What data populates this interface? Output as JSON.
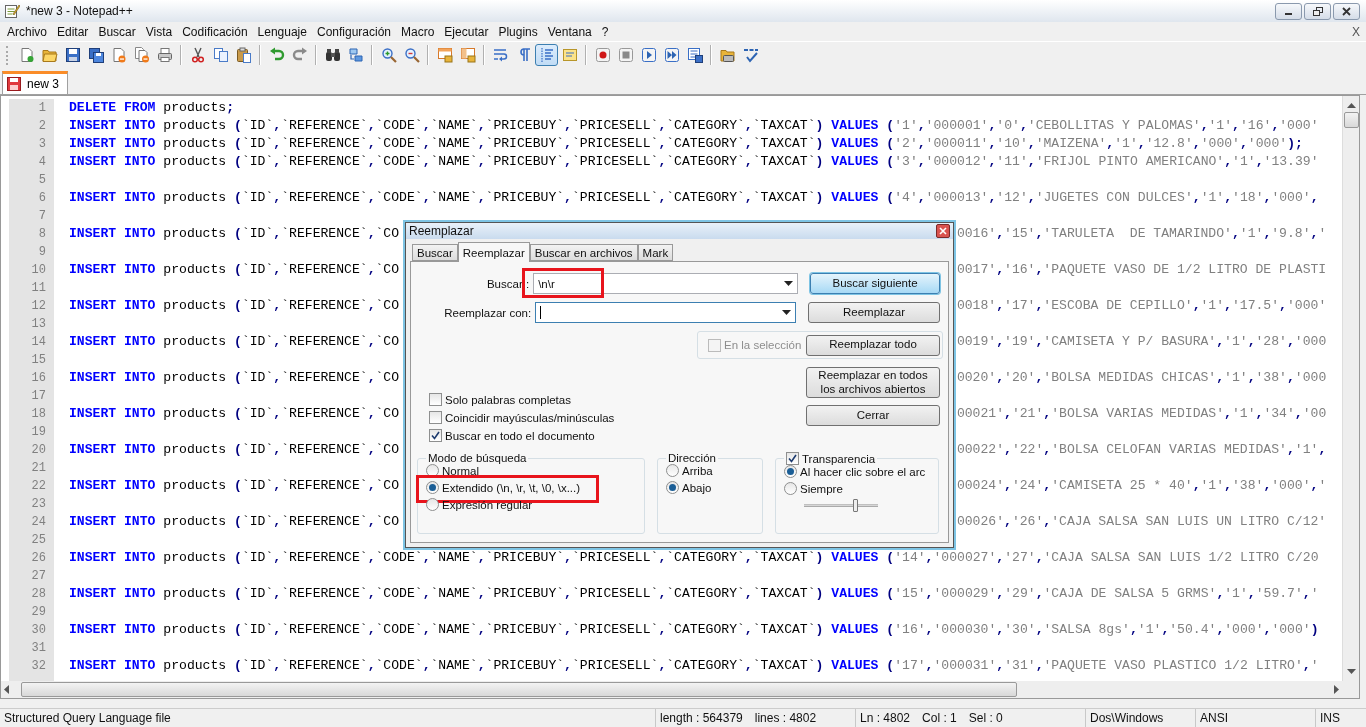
{
  "window": {
    "title": "*new 3 - Notepad++",
    "close_document": "X"
  },
  "menu": [
    "Archivo",
    "Editar",
    "Buscar",
    "Vista",
    "Codificación",
    "Lenguaje",
    "Configuración",
    "Macro",
    "Ejecutar",
    "Plugins",
    "Ventana",
    "?"
  ],
  "toolbar": [
    [
      {
        "pressed": false
      },
      {
        "pressed": false
      },
      {
        "pressed": false
      },
      {
        "pressed": false
      },
      {
        "pressed": false
      },
      {
        "pressed": false
      },
      {
        "pressed": false
      }
    ],
    [
      {
        "pressed": false
      },
      {
        "pressed": false
      },
      {
        "pressed": false
      }
    ],
    [
      {
        "pressed": false
      },
      {
        "pressed": false
      }
    ],
    [
      {
        "pressed": false
      },
      {
        "pressed": false
      }
    ],
    [
      {
        "pressed": false
      },
      {
        "pressed": false
      }
    ],
    [
      {
        "pressed": false
      },
      {
        "pressed": false
      }
    ],
    [
      {
        "pressed": false
      },
      {
        "pressed": false
      },
      {
        "pressed": true
      },
      {
        "pressed": false
      }
    ],
    [
      {
        "pressed": false
      },
      {
        "pressed": false
      },
      {
        "pressed": false
      },
      {
        "pressed": false
      },
      {
        "pressed": false
      }
    ],
    [
      {
        "pressed": false
      },
      {
        "pressed": false
      }
    ]
  ],
  "tabs": [
    {
      "label": "new 3",
      "selected": true
    }
  ],
  "editor": {
    "lines": [
      {
        "number": "1",
        "text": "DELETE FROM products;"
      },
      {
        "number": "2",
        "text": "INSERT INTO products (`ID`,`REFERENCE`,`CODE`,`NAME`,`PRICEBUY`,`PRICESELL`,`CATEGORY`,`TAXCAT`) VALUES ('1','000001','0','CEBOLLITAS Y PALOMAS','1','16','000'"
      },
      {
        "number": "3",
        "text": "INSERT INTO products (`ID`,`REFERENCE`,`CODE`,`NAME`,`PRICEBUY`,`PRICESELL`,`CATEGORY`,`TAXCAT`) VALUES ('2','000011','10','MAIZENA','1','12.8','000','000');"
      },
      {
        "number": "4",
        "text": "INSERT INTO products (`ID`,`REFERENCE`,`CODE`,`NAME`,`PRICEBUY`,`PRICESELL`,`CATEGORY`,`TAXCAT`) VALUES ('3','000012','11','FRIJOL PINTO AMERICANO','1','13.39'"
      },
      {
        "number": "5"
      },
      {
        "number": "6",
        "text": "INSERT INTO products (`ID`,`REFERENCE`,`CODE`,`NAME`,`PRICEBUY`,`PRICESELL`,`CATEGORY`,`TAXCAT`) VALUES ('4','000013','12','JUGETES CON DULCES','1','18','000',"
      },
      {
        "number": "7"
      },
      {
        "number": "8",
        "text": "INSERT INTO products (`ID`,`REFERENCE`,`CO",
        "text_right": "0016','15','TARULETA  DE TAMARINDO','1','9.8','"
      },
      {
        "number": "9"
      },
      {
        "number": "10",
        "text": "INSERT INTO products (`ID`,`REFERENCE`,`CO",
        "text_right": "0017','16','PAQUETE VASO DE 1/2 LITRO DE PLASTI"
      },
      {
        "number": "11"
      },
      {
        "number": "12",
        "text": "INSERT INTO products (`ID`,`REFERENCE`,`CO",
        "text_right": "0018','17','ESCOBA DE CEPILLO','1','17.5','000'"
      },
      {
        "number": "13"
      },
      {
        "number": "14",
        "text": "INSERT INTO products (`ID`,`REFERENCE`,`CO",
        "text_right": "0019','19','CAMISETA Y P/ BASURA','1','28','000"
      },
      {
        "number": "15"
      },
      {
        "number": "16",
        "text": "INSERT INTO products (`ID`,`REFERENCE`,`CO",
        "text_right": "0020','20','BOLSA MEDIDAS CHICAS','1','38','000"
      },
      {
        "number": "17"
      },
      {
        "number": "18",
        "text": "INSERT INTO products (`ID`,`REFERENCE`,`CO",
        "text_right": "00021','21','BOLSA VARIAS MEDIDAS','1','34','00"
      },
      {
        "number": "19"
      },
      {
        "number": "20",
        "text": "INSERT INTO products (`ID`,`REFERENCE`,`CO",
        "text_right": "00022','22','BOLSA CELOFAN VARIAS MEDIDAS','1',"
      },
      {
        "number": "21"
      },
      {
        "number": "22",
        "text": "INSERT INTO products (`ID`,`REFERENCE`,`CO",
        "text_right": "00024','24','CAMISETA 25 * 40','1','38','000','"
      },
      {
        "number": "23"
      },
      {
        "number": "24",
        "text": "INSERT INTO products (`ID`,`REFERENCE`,`CO",
        "text_right": "00026','26','CAJA SALSA SAN LUIS UN LITRO C/12'"
      },
      {
        "number": "25"
      },
      {
        "number": "26",
        "text": "INSERT INTO products (`ID`,`REFERENCE`,`CODE`,`NAME`,`PRICEBUY`,`PRICESELL`,`CATEGORY`,`TAXCAT`) VALUES ('14','000027','27','CAJA SALSA SAN LUIS 1/2 LITRO C/20"
      },
      {
        "number": "27"
      },
      {
        "number": "28",
        "text": "INSERT INTO products (`ID`,`REFERENCE`,`CODE`,`NAME`,`PRICEBUY`,`PRICESELL`,`CATEGORY`,`TAXCAT`) VALUES ('15','000029','29','CAJA DE SALSA 5 GRMS','1','59.7','"
      },
      {
        "number": "29"
      },
      {
        "number": "30",
        "text": "INSERT INTO products (`ID`,`REFERENCE`,`CODE`,`NAME`,`PRICEBUY`,`PRICESELL`,`CATEGORY`,`TAXCAT`) VALUES ('16','000030','30','SALSA 8gs','1','50.4','000','000')"
      },
      {
        "number": "31"
      },
      {
        "number": "32",
        "text": "INSERT INTO products (`ID`,`REFERENCE`,`CODE`,`NAME`,`PRICEBUY`,`PRICESELL`,`CATEGORY`,`TAXCAT`) VALUES ('17','000031','31','PAQUETE VASO PLASTICO 1/2 LITRO','"
      }
    ]
  },
  "dialog": {
    "title": "Reemplazar",
    "tabs": [
      {
        "label": "Buscar",
        "selected": false
      },
      {
        "label": "Reemplazar",
        "selected": true
      },
      {
        "label": "Buscar en archivos",
        "selected": false
      },
      {
        "label": "Mark",
        "selected": false
      }
    ],
    "find": {
      "label": "Buscar :",
      "value": "\\n\\r",
      "highlighted": true
    },
    "replace": {
      "label": "Reemplazar con:",
      "focused": true
    },
    "buttons": [
      {
        "label": "Buscar siguiente",
        "default": true
      },
      {
        "label": "Reemplazar",
        "default": false
      },
      {
        "label": "Reemplazar todo",
        "default": false
      },
      {
        "label": "Reemplazar en todos los archivos abiertos",
        "default": false
      },
      {
        "label": "Cerrar",
        "default": false
      }
    ],
    "in_selection": {
      "label": "En la selección",
      "checked": false,
      "disabled": true
    },
    "options": [
      {
        "label": "Solo palabras completas",
        "checked": false
      },
      {
        "label": "Coincidir mayúsculas/minúsculas",
        "checked": false
      },
      {
        "label": "Buscar en todo el documento",
        "checked": true
      }
    ],
    "search_mode": {
      "title": "Modo de búsqueda",
      "options": [
        {
          "label": "Normal",
          "selected": false,
          "highlighted": false
        },
        {
          "label": "Extendido (\\n, \\r, \\t, \\0, \\x...)",
          "selected": true,
          "highlighted": true
        },
        {
          "label": "Expresión regular",
          "selected": false,
          "highlighted": false
        }
      ]
    },
    "direction": {
      "title": "Dirección",
      "options": [
        {
          "label": "Arriba",
          "selected": false
        },
        {
          "label": "Abajo",
          "selected": true
        }
      ]
    },
    "transparency": {
      "label": "Transparencia",
      "checked": true,
      "options": [
        {
          "label": "Al hacer clic sobre el arc",
          "selected": true
        },
        {
          "label": "Siempre",
          "selected": false
        }
      ],
      "level": 0.72
    }
  },
  "status_bar": [
    [
      "Structured Query Language file"
    ],
    [
      "length : 564379",
      "lines : 4802"
    ],
    [
      "Ln : 4802",
      "Col : 1",
      "Sel : 0"
    ],
    [
      "Dos\\Windows"
    ],
    [
      "ANSI"
    ],
    [
      "INS"
    ]
  ]
}
